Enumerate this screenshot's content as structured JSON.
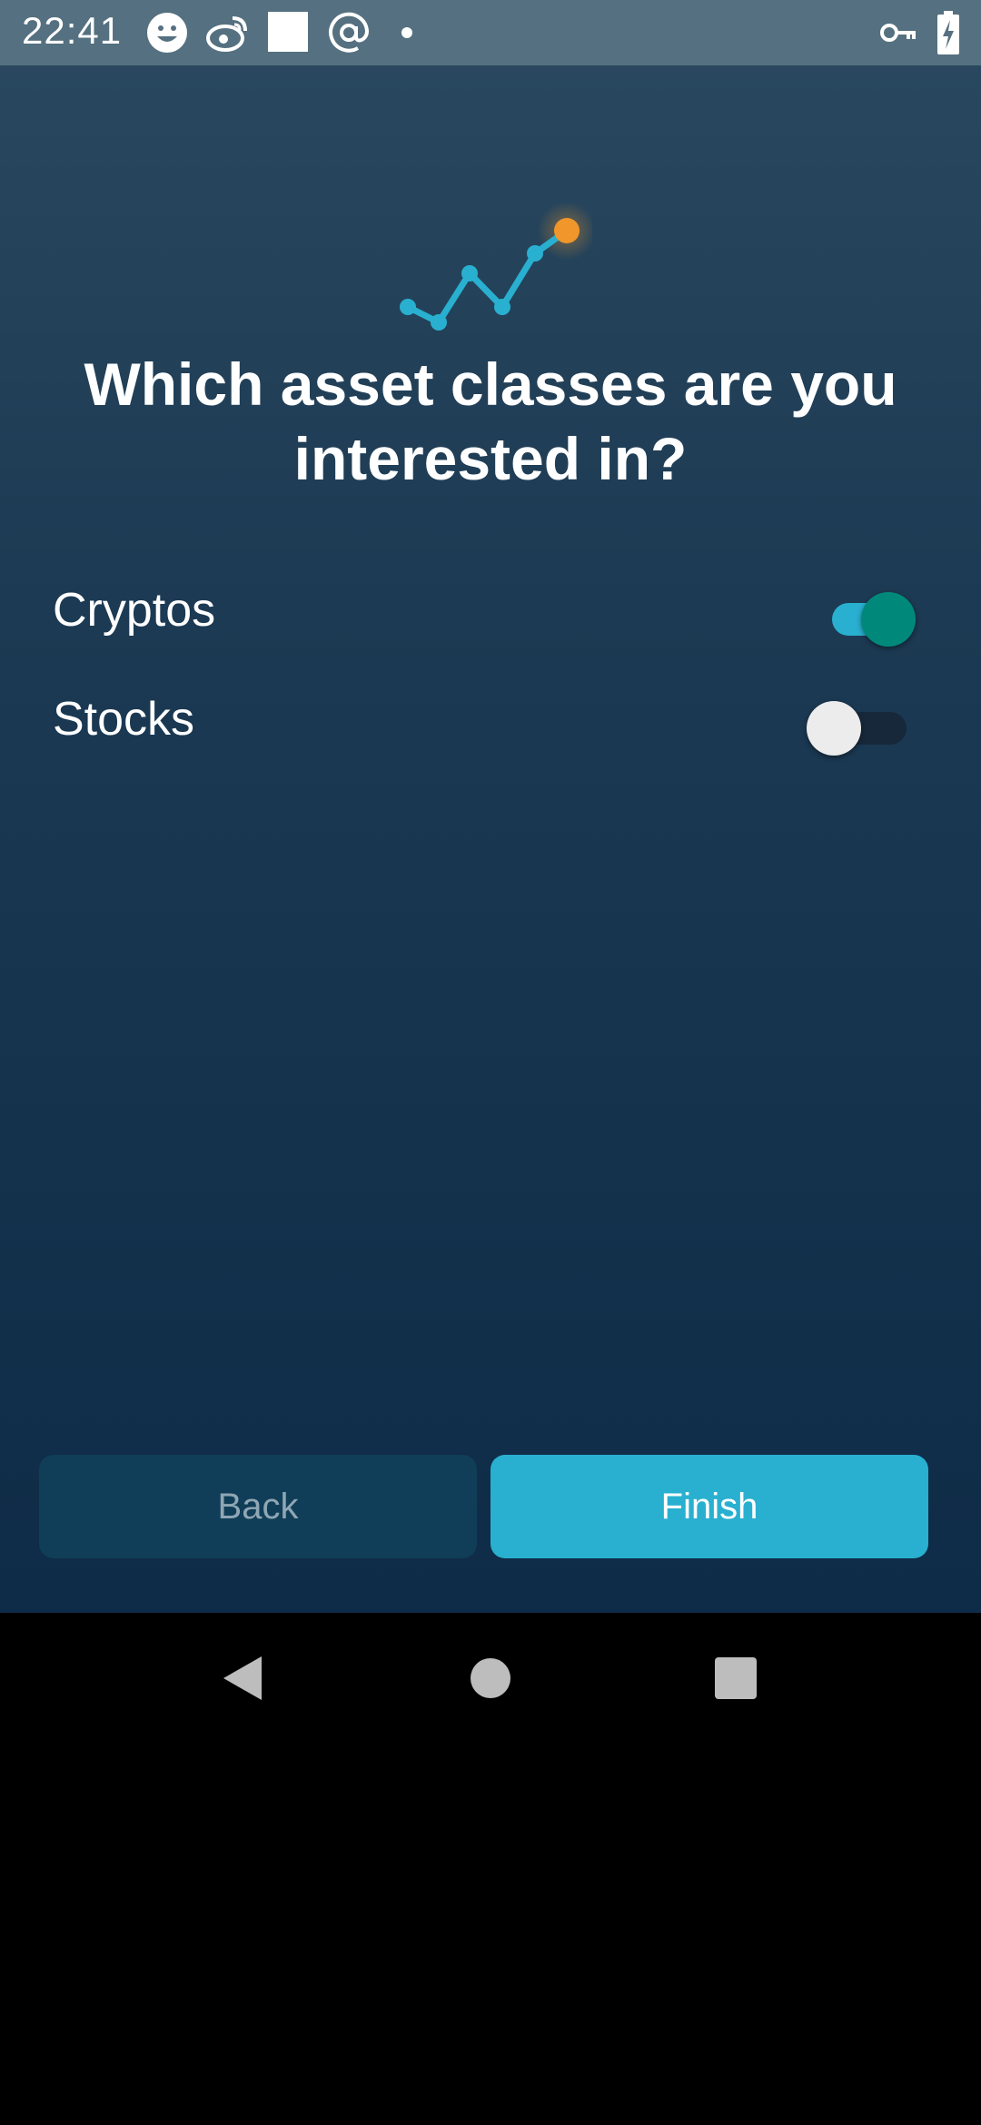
{
  "status_bar": {
    "time": "22:41",
    "icons": [
      "smiley-icon",
      "weibo-icon",
      "square-icon",
      "at-icon",
      "dot-icon",
      "key-icon",
      "battery-charging-icon"
    ]
  },
  "screen": {
    "title": "Which asset classes are you interested in?",
    "options": [
      {
        "label": "Cryptos",
        "enabled": true
      },
      {
        "label": "Stocks",
        "enabled": false
      }
    ],
    "back_label": "Back",
    "finish_label": "Finish"
  },
  "nav_bar": {
    "icons": [
      "back-triangle-icon",
      "home-circle-icon",
      "recents-square-icon"
    ]
  },
  "colors": {
    "accent": "#29b0d0",
    "toggle_on_thumb": "#00897b",
    "logo_highlight": "#f0962a",
    "background_top": "#29485f",
    "background_bottom": "#0e2b47"
  }
}
